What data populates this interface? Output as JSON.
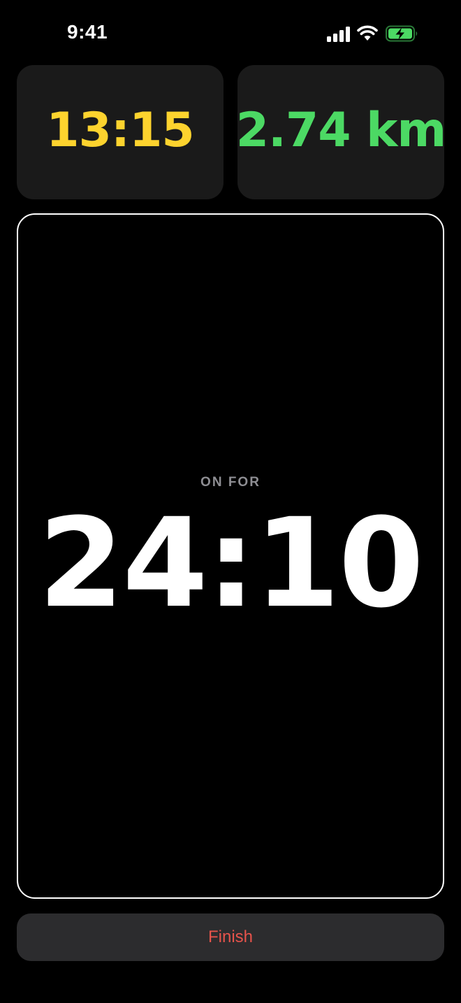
{
  "status_bar": {
    "time": "9:41",
    "signal_icon": "cellular-signal-icon",
    "wifi_icon": "wifi-icon",
    "battery_icon": "battery-charging-icon"
  },
  "stats": {
    "pace": {
      "value": "13:15",
      "color": "#fdd32e"
    },
    "distance": {
      "value": "2.74 km",
      "color": "#4cd964"
    }
  },
  "timer": {
    "label": "ON FOR",
    "value": "24:10"
  },
  "actions": {
    "finish_label": "Finish"
  },
  "colors": {
    "background": "#000000",
    "card": "#1a1a1a",
    "button": "#2c2c2e",
    "finish_text": "#e5534b",
    "battery_green": "#4cd964"
  }
}
